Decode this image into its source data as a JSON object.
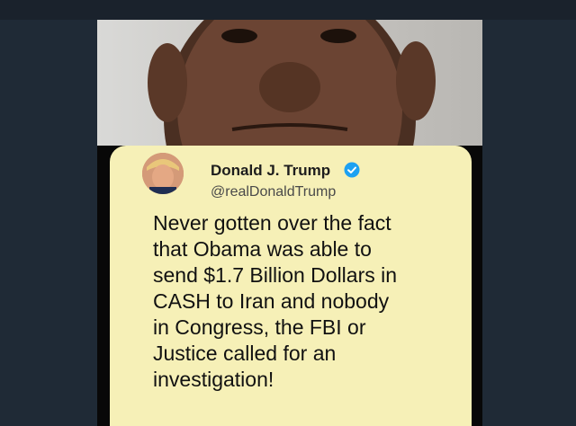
{
  "colors": {
    "page_background": "#1c2530",
    "note_background": "#f6f0b7",
    "verified_badge": "#1da1f2"
  },
  "tweet": {
    "author_name": "Donald J. Trump",
    "handle": "@realDonaldTrump",
    "verified_icon": "verified-badge-icon",
    "text_lines": [
      "Never gotten over the fact",
      "that Obama was able to",
      "send $1.7 Billion Dollars in",
      "CASH to Iran and nobody",
      "in Congress, the FBI or",
      "Justice called for an",
      "investigation!"
    ]
  }
}
